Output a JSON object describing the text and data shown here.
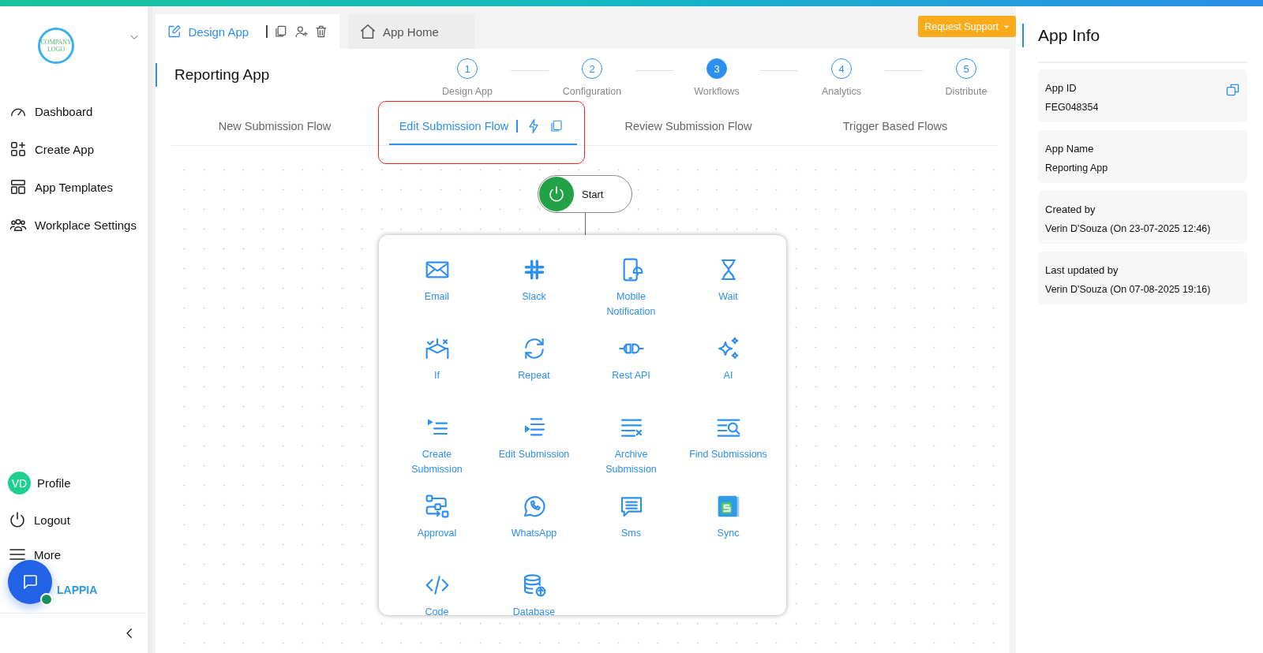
{
  "sidebar": {
    "logo_text": "COMPANY LOGO",
    "nav": [
      {
        "label": "Dashboard"
      },
      {
        "label": "Create App"
      },
      {
        "label": "App Templates"
      },
      {
        "label": "Workplace Settings"
      }
    ],
    "profile": {
      "initials": "VD",
      "label": "Profile"
    },
    "bottom": [
      {
        "label": "Logout"
      },
      {
        "label": "More"
      }
    ],
    "brand": "LAPPIA"
  },
  "top_tabs": [
    {
      "label": "Design App",
      "selected": true
    },
    {
      "label": "App Home",
      "selected": false
    }
  ],
  "support_button": "Request Support",
  "app_title": "Reporting App",
  "steps": [
    {
      "number": "1",
      "label": "Design App",
      "selected": false
    },
    {
      "number": "2",
      "label": "Configuration",
      "selected": false
    },
    {
      "number": "3",
      "label": "Workflows",
      "selected": true
    },
    {
      "number": "4",
      "label": "Analytics",
      "selected": false
    },
    {
      "number": "5",
      "label": "Distribute",
      "selected": false
    }
  ],
  "flow_tabs": [
    {
      "label": "New Submission Flow",
      "selected": false,
      "highlighted": false
    },
    {
      "label": "Edit Submission Flow",
      "selected": true,
      "highlighted": true
    },
    {
      "label": "Review Submission Flow",
      "selected": false,
      "highlighted": false
    },
    {
      "label": "Trigger Based Flows",
      "selected": false,
      "highlighted": false
    }
  ],
  "start_node": "Start",
  "actions": [
    {
      "label": "Email"
    },
    {
      "label": "Slack"
    },
    {
      "label": "Mobile Notification"
    },
    {
      "label": "Wait"
    },
    {
      "label": "If"
    },
    {
      "label": "Repeat"
    },
    {
      "label": "Rest API"
    },
    {
      "label": "AI"
    },
    {
      "label": "Create Submission"
    },
    {
      "label": "Edit Submission"
    },
    {
      "label": "Archive Submission"
    },
    {
      "label": "Find Submissions"
    },
    {
      "label": "Approval"
    },
    {
      "label": "WhatsApp"
    },
    {
      "label": "Sms"
    },
    {
      "label": "Sync"
    },
    {
      "label": "Code"
    },
    {
      "label": "Database"
    }
  ],
  "app_info": {
    "title": "App Info",
    "fields": [
      {
        "label": "App ID",
        "value": "FEG048354",
        "copyable": true
      },
      {
        "label": "App Name",
        "value": "Reporting App",
        "copyable": false
      },
      {
        "label": "Created by",
        "value": "Verin D'Souza (On 23-07-2025 12:46)",
        "copyable": false
      },
      {
        "label": "Last updated by",
        "value": "Verin D'Souza (On 07-08-2025 19:16)",
        "copyable": false
      }
    ]
  }
}
